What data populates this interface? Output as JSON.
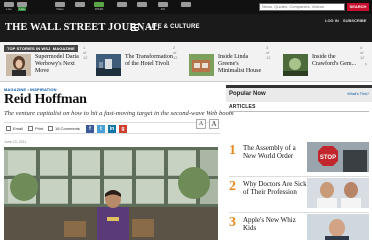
{
  "topbar": {
    "items": [
      {
        "label": "Live"
      },
      {
        "label": "Video"
      },
      {
        "label": ""
      },
      {
        "label": "WSJD"
      },
      {
        "label": ""
      },
      {
        "label": ""
      },
      {
        "label": ""
      },
      {
        "label": "ES"
      },
      {
        "label": ""
      }
    ],
    "search_placeholder": "News, Quotes, Companies, Videos",
    "search_button": "SEARCH"
  },
  "masthead": {
    "logo": "THE WALL STREET JOURNAL",
    "section": "LIFE & CULTURE",
    "login": "LOG IN",
    "subscribe": "SUBSCRIBE"
  },
  "top_stories": {
    "label": "TOP STORIES IN WSJ. MAGAZINE",
    "stories": [
      {
        "num": "1 of 12",
        "title": "Supermodel Daria Werbowy's Next Move"
      },
      {
        "num": "2 of 12",
        "title": "The Transformation of the Hotel Tivoli"
      },
      {
        "num": "3 of 12",
        "title": "Inside Linda Greene's Minimalist House"
      },
      {
        "num": "4 of 12",
        "title": "Inside the Crawford's Gem..."
      }
    ]
  },
  "article": {
    "breadcrumb": "MAGAZINE • INSPIRATION",
    "headline": "Reid Hoffman",
    "dek": "The venture capitalist on how to hit a fast-moving target in the second-wave Web boom",
    "email_label": "Email",
    "print_label": "Print",
    "comments_label": "18 Comments",
    "font_small": "A",
    "font_large": "A",
    "dateline": "June 23, 2011"
  },
  "popular": {
    "heading": "Popular Now",
    "whats_this": "What's This?",
    "articles_label": "ARTICLES",
    "items": [
      {
        "num": "1",
        "title": "The Assembly of a New World Order"
      },
      {
        "num": "2",
        "title": "Why Doctors Are Sick of Their Profession"
      },
      {
        "num": "3",
        "title": "Apple's New Whiz Kids"
      }
    ]
  },
  "colors": {
    "accent_red": "#c8102e",
    "popular_number": "#e8891d",
    "link_blue": "#0a5aa8"
  }
}
